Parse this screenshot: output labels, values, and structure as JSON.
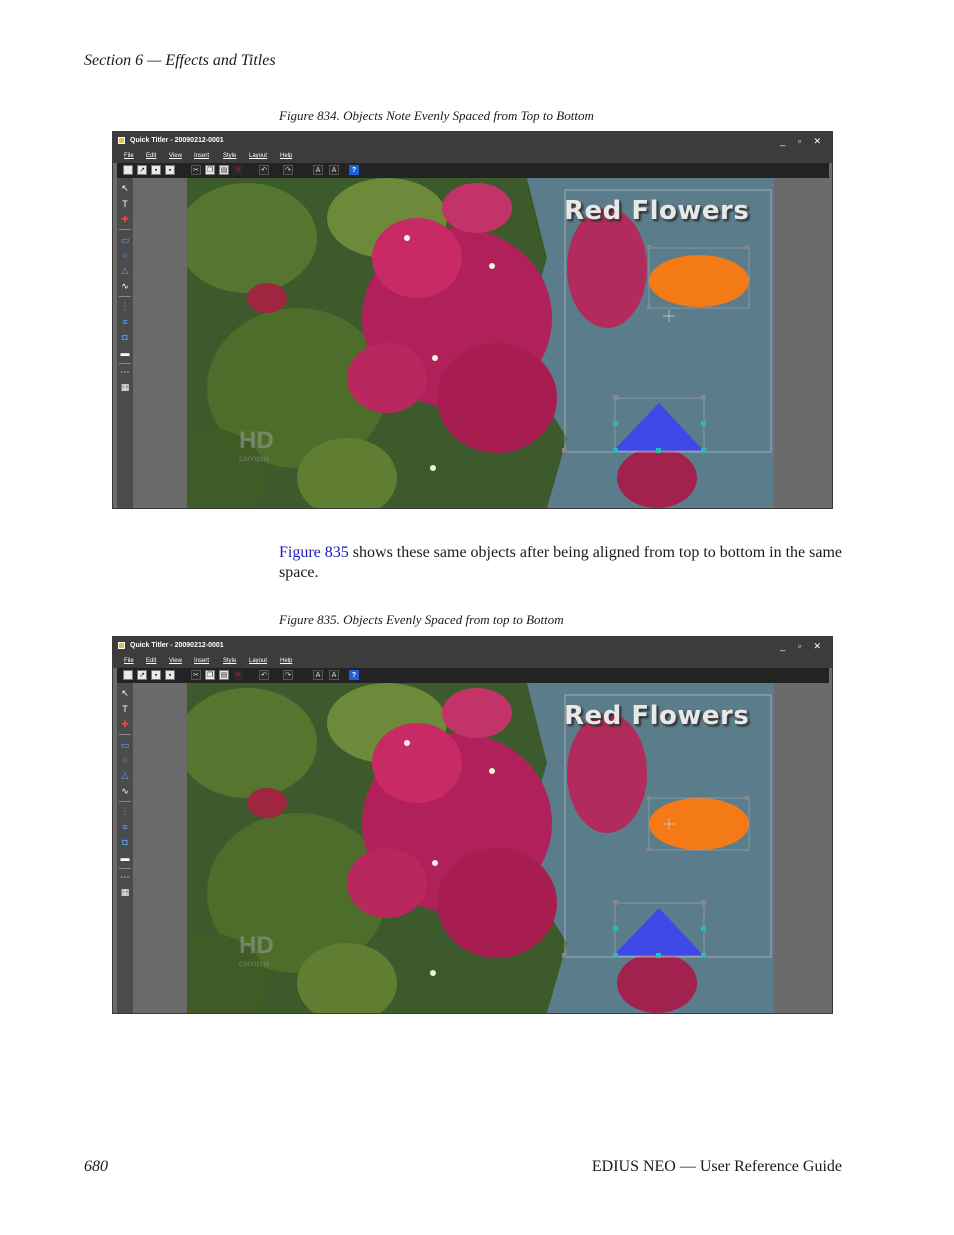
{
  "page": {
    "section_header": "Section 6 — Effects and Titles",
    "figure834_caption": "Figure 834. Objects Note Evenly Spaced from Top to Bottom",
    "body_link": "Figure 835",
    "body_text": " shows these same objects after being aligned from top to bottom in the same space.",
    "figure835_caption": "Figure 835. Objects Evenly Spaced from top to Bottom",
    "page_number": "680",
    "footer_title": "EDIUS NEO — User Reference Guide"
  },
  "app": {
    "title": "Quick Titler - 20090212-0001",
    "window_buttons": "_ ▫ ✕",
    "menu": [
      "File",
      "Edit",
      "View",
      "Insert",
      "Style",
      "Layout",
      "Help"
    ],
    "canvas_title_text": "Red Flowers",
    "watermark": "HD",
    "watermark_sub": "canopus"
  },
  "colors": {
    "ellipse": "#f47a16",
    "triangle": "#3e4ae8",
    "link": "#1a1ab8"
  }
}
